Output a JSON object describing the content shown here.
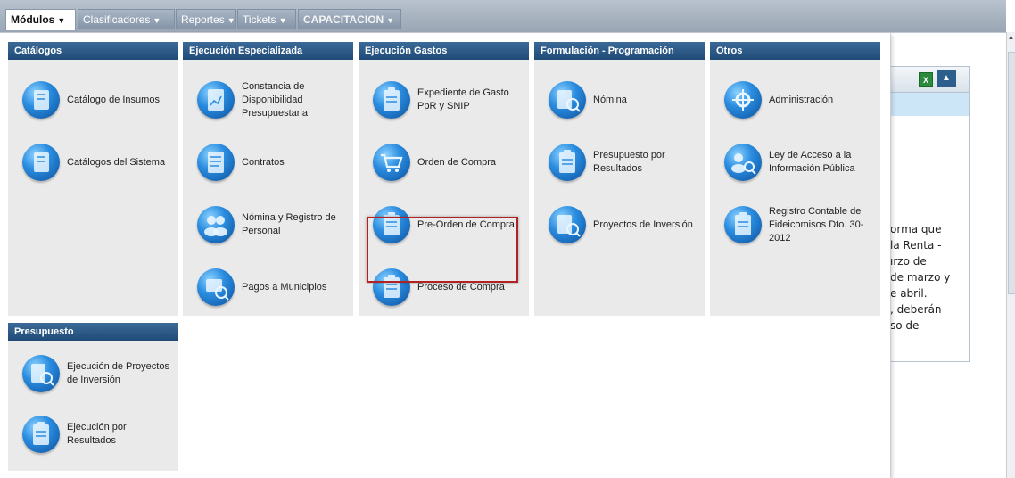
{
  "menubar": {
    "modulos": "Módulos",
    "clasificadores": "Clasificadores",
    "reportes": "Reportes",
    "tickets": "Tickets",
    "capacitacion": "CAPACITACION"
  },
  "columns": [
    {
      "title": "Catálogos",
      "items": [
        {
          "label": "Catálogo de Insumos",
          "icon": "book-icon"
        },
        {
          "label": "Catálogos del Sistema",
          "icon": "book-icon"
        }
      ]
    },
    {
      "title": "Ejecución Especializada",
      "items": [
        {
          "label": "Constancia de Disponibilidad Presupuestaria",
          "icon": "clipboard-chart-icon"
        },
        {
          "label": "Contratos",
          "icon": "document-icon"
        },
        {
          "label": "Nómina y Registro de Personal",
          "icon": "people-icon"
        },
        {
          "label": "Pagos a Municipios",
          "icon": "money-search-icon"
        }
      ]
    },
    {
      "title": "Ejecución Gastos",
      "items": [
        {
          "label": "Expediente de Gasto PpR y SNIP",
          "icon": "clipboard-icon"
        },
        {
          "label": "Orden de Compra",
          "icon": "cart-icon"
        },
        {
          "label": "Pre-Orden de Compra",
          "icon": "clipboard-icon"
        },
        {
          "label": "Proceso de Compra",
          "icon": "clipboard-icon"
        }
      ]
    },
    {
      "title": "Formulación - Programación",
      "items": [
        {
          "label": "Nómina",
          "icon": "payroll-search-icon"
        },
        {
          "label": "Presupuesto por Resultados",
          "icon": "clipboard-icon"
        },
        {
          "label": "Proyectos de Inversión",
          "icon": "project-search-icon"
        }
      ]
    },
    {
      "title": "Otros",
      "items": [
        {
          "label": "Administración",
          "icon": "tools-icon"
        },
        {
          "label": "Ley de Acceso a la Información Pública",
          "icon": "people-search-icon"
        },
        {
          "label": "Registro Contable de Fideicomisos Dto. 30-2012",
          "icon": "clipboard-icon"
        }
      ]
    },
    {
      "title": "Presupuesto",
      "items": [
        {
          "label": "Ejecución de Proyectos de Inversión",
          "icon": "project-search-icon"
        },
        {
          "label": "Ejecución por Resultados",
          "icon": "clipboard-icon"
        }
      ]
    }
  ],
  "background_text": [
    "orma que",
    "la Renta -",
    "ırzo de",
    "de marzo y",
    "e abril.",
    ", deberán",
    "so de"
  ],
  "highlighted_item": "Pre-Orden de Compra",
  "colors": {
    "header_blue": "#1f4a77",
    "highlight_red": "#b22222",
    "panel_grey": "#eaeaea"
  }
}
